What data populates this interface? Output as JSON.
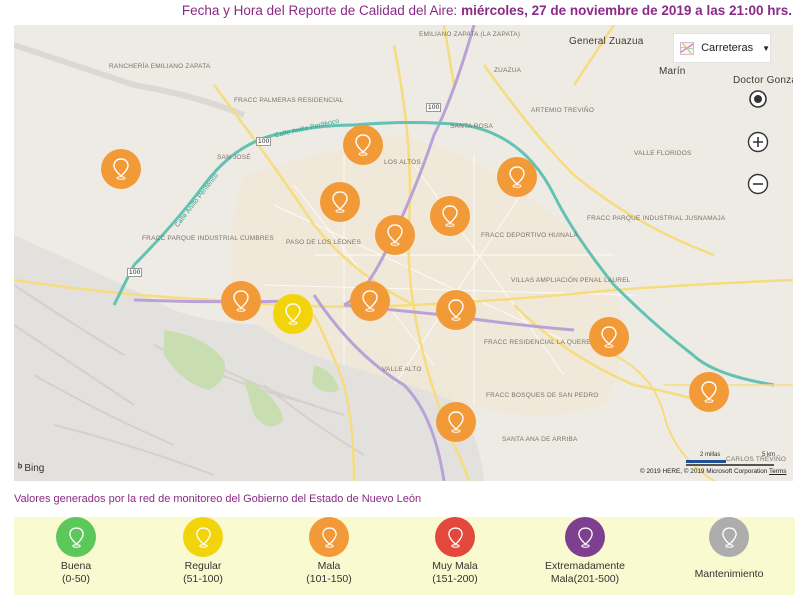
{
  "header": {
    "prefix": "Fecha y Hora del Reporte de Calidad del Aire:",
    "date": "miércoles, 27 de noviembre de 2019 a las 21:00 hrs."
  },
  "map": {
    "style_selector": {
      "label": "Carreteras",
      "icon": "map-style-icon"
    },
    "controls": {
      "locate": {
        "icon": "locate-icon"
      },
      "zoom_in": {
        "icon": "zoom-in-icon"
      },
      "zoom_out": {
        "icon": "zoom-out-icon"
      }
    },
    "provider": "Bing",
    "scale": {
      "miles": "2 millas",
      "km": "5 km"
    },
    "copyright": "© 2019 HERE, © 2019 Microsoft Corporation",
    "terms": "Terms",
    "labels": [
      "RANCHERÍA EMILIANO ZAPATA",
      "FRACC PALMERAS RESIDENCIAL",
      "SAN JOSÉ",
      "Calle Anillo Periférico",
      "Calle Anillo Periférico",
      "FRACC PARQUE INDUSTRIAL CUMBRES",
      "PASO DE LOS LEONES",
      "LOS ALTOS",
      "SANTA ROSA",
      "EMILIANO ZAPATA (LA ZAPATA)",
      "General Zuazua",
      "ZUAZUA",
      "ARTEMIO TREVIÑO",
      "Marín",
      "Doctor González",
      "VALLE FLORIDOS",
      "FRACC PARQUE INDUSTRIAL JUSNAMAJA",
      "FRACC DEPORTIVO HUINALÁ",
      "VILLAS AMPLIACIÓN PENAL LAUREL",
      "FRACC RESIDENCIAL LA QUERENCIA",
      "VALLE ALTO",
      "FRACC BOSQUES DE SAN PEDRO",
      "SANTA ANA DE ARRIBA",
      "CARLOS TREVIÑO",
      "100",
      "100",
      "100"
    ],
    "stations": [
      {
        "name": "station-north-west",
        "level": "Mala"
      },
      {
        "name": "station-north",
        "level": "Mala"
      },
      {
        "name": "station-north-east",
        "level": "Mala"
      },
      {
        "name": "station-escobedo",
        "level": "Mala"
      },
      {
        "name": "station-san-nicolas",
        "level": "Mala"
      },
      {
        "name": "station-apodaca",
        "level": "Mala"
      },
      {
        "name": "station-santa-catarina",
        "level": "Mala"
      },
      {
        "name": "station-san-pedro",
        "level": "Regular"
      },
      {
        "name": "station-centro",
        "level": "Mala"
      },
      {
        "name": "station-guadalupe",
        "level": "Mala"
      },
      {
        "name": "station-juarez",
        "level": "Mala"
      },
      {
        "name": "station-pesqueria",
        "level": "Mala"
      },
      {
        "name": "station-sur",
        "level": "Mala"
      }
    ]
  },
  "note": "Valores generados por la red de monitoreo del Gobierno del Estado de Nuevo León",
  "legend": [
    {
      "label": "Buena",
      "range": "(0-50)",
      "color": "#5cc75a"
    },
    {
      "label": "Regular",
      "range": "(51-100)",
      "color": "#f2d40c"
    },
    {
      "label": "Mala",
      "range": "(101-150)",
      "color": "#f29a38"
    },
    {
      "label": "Muy Mala",
      "range": "(151-200)",
      "color": "#e2483c"
    },
    {
      "label": "Extremadamente",
      "range": "Mala(201-500)",
      "color": "#7d3f8e"
    },
    {
      "label": "Mantenimiento",
      "range": "",
      "color": "#adadad"
    }
  ],
  "colors": {
    "accent": "#8b2a86",
    "legend_bg": "#fafad1",
    "Mala": "#f29a38",
    "Regular": "#f2d40c"
  }
}
